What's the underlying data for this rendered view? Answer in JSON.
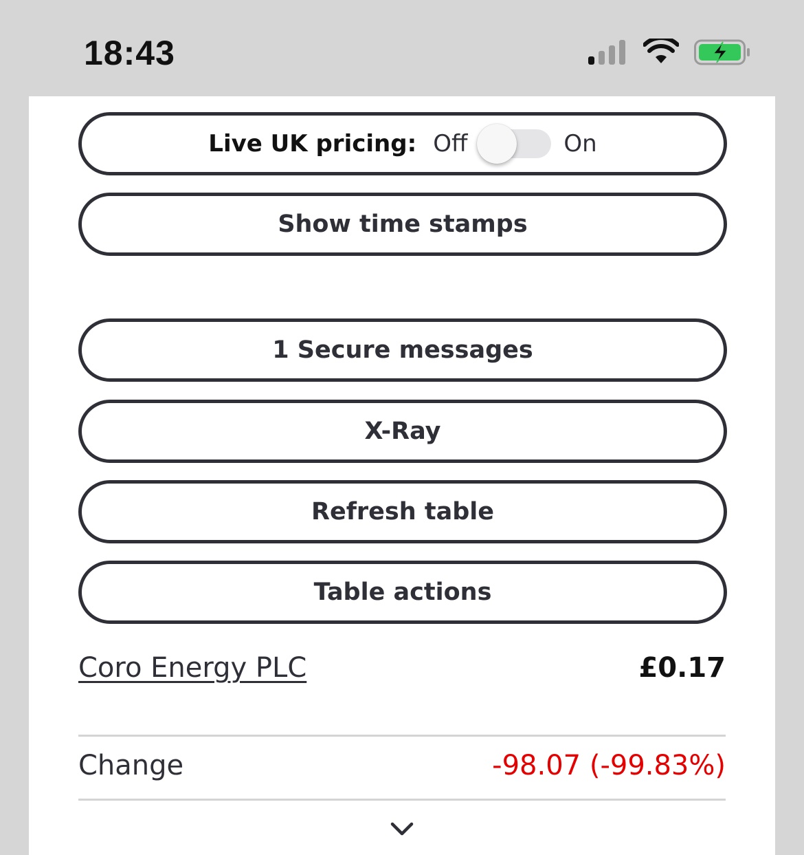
{
  "status_bar": {
    "time": "18:43",
    "icons": [
      "cellular-signal-icon",
      "wifi-icon",
      "battery-charging-icon"
    ],
    "battery_color": "#34c759"
  },
  "pricing_toggle": {
    "label": "Live UK pricing:",
    "off_label": "Off",
    "on_label": "On",
    "state": "off"
  },
  "buttons": {
    "show_time_stamps": "Show time stamps",
    "secure_messages": "1 Secure messages",
    "xray": "X-Ray",
    "refresh_table": "Refresh table",
    "table_actions": "Table actions"
  },
  "holding": {
    "name": "Coro Energy PLC",
    "price": "£0.17",
    "change_label": "Change",
    "change_value": "-98.07 (-99.83%)",
    "change_color": "#e50000",
    "expand_icon": "chevron-down-icon"
  }
}
